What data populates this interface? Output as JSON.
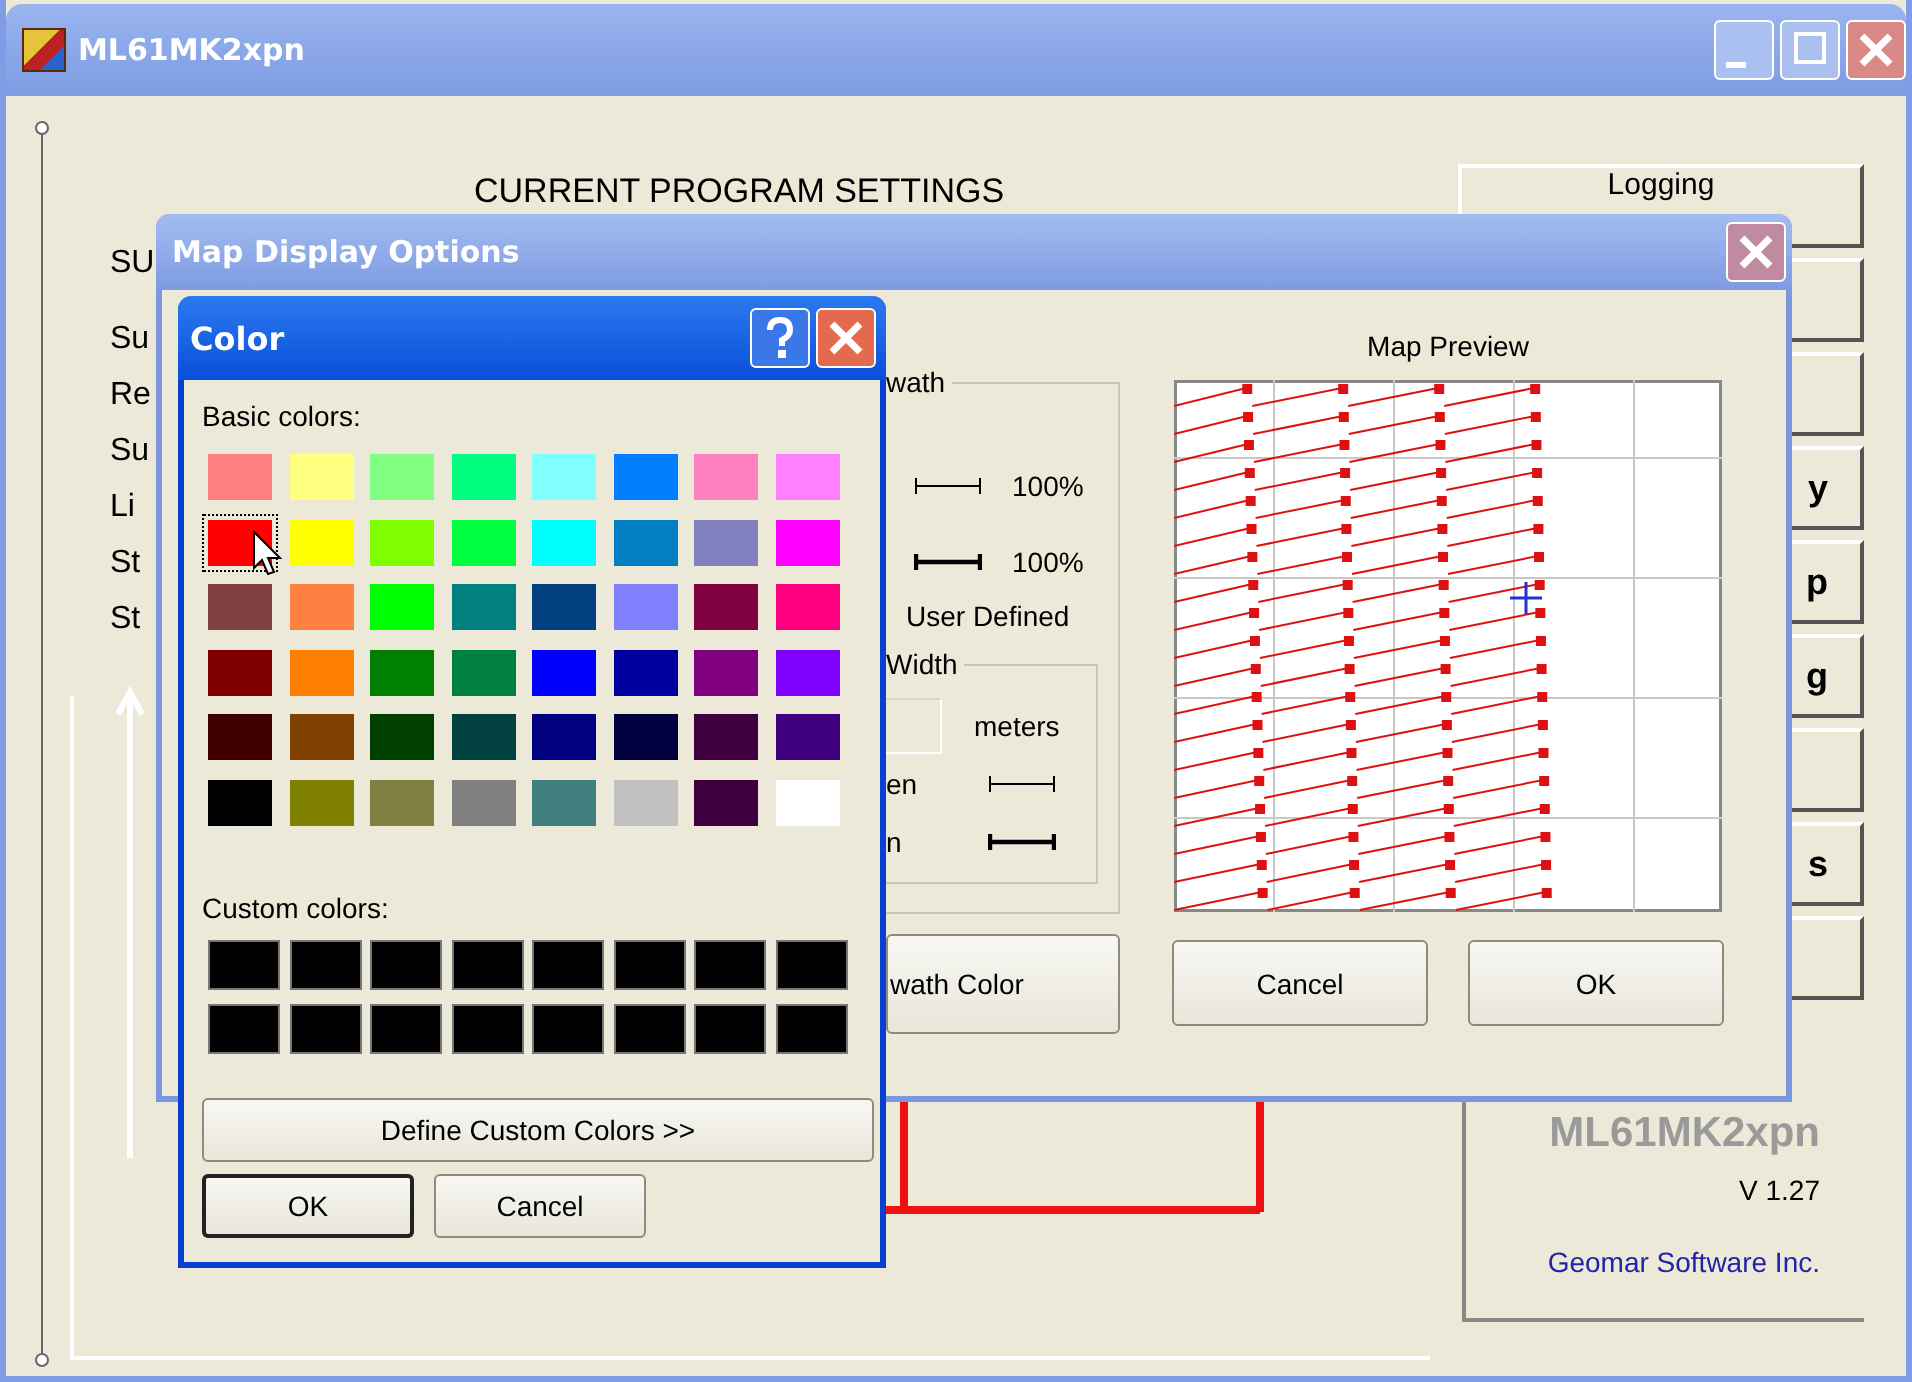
{
  "main_window": {
    "title": "ML61MK2xpn",
    "heading": "CURRENT PROGRAM SETTINGS",
    "setting_labels": [
      "SU",
      "Su",
      "Re",
      "Su",
      "Li",
      "St",
      "St"
    ],
    "buttons": [
      {
        "kind": "text",
        "label": "Logging"
      },
      {
        "kind": "blank"
      },
      {
        "kind": "blank"
      },
      {
        "kind": "text",
        "label": "y"
      },
      {
        "kind": "text",
        "label": "p"
      },
      {
        "kind": "text",
        "label": "g"
      },
      {
        "kind": "blank"
      },
      {
        "kind": "text",
        "label": "s"
      },
      {
        "kind": "blank"
      }
    ],
    "product_name": "ML61MK2xpn",
    "version": "V 1.27",
    "company": "Geomar Software Inc."
  },
  "map_dialog": {
    "title": "Map Display Options",
    "swath_group": "wath",
    "swath_rows": [
      {
        "kind": "thin",
        "value": "100%"
      },
      {
        "kind": "thick",
        "value": "100%"
      }
    ],
    "user_defined": "User Defined",
    "width_group": "Width",
    "width_unit": "meters",
    "width_rows": [
      {
        "kind": "thin",
        "label": "en"
      },
      {
        "kind": "thick",
        "label": "n"
      }
    ],
    "swath_color_button": "wath Color",
    "preview_title": "Map Preview",
    "buttons": [
      "Cancel",
      "OK"
    ]
  },
  "color_dialog": {
    "title": "Color",
    "basic_label": "Basic colors:",
    "basic_colors": [
      {
        "color": "#ff8080",
        "selected": false
      },
      {
        "color": "#ffff80",
        "selected": false
      },
      {
        "color": "#80ff80",
        "selected": false
      },
      {
        "color": "#00ff80",
        "selected": false
      },
      {
        "color": "#80ffff",
        "selected": false
      },
      {
        "color": "#0080ff",
        "selected": false
      },
      {
        "color": "#ff80c0",
        "selected": false
      },
      {
        "color": "#ff80ff",
        "selected": false
      },
      {
        "color": "#ff0000",
        "selected": true
      },
      {
        "color": "#ffff00",
        "selected": false
      },
      {
        "color": "#80ff00",
        "selected": false
      },
      {
        "color": "#00ff40",
        "selected": false
      },
      {
        "color": "#00ffff",
        "selected": false
      },
      {
        "color": "#0080c0",
        "selected": false
      },
      {
        "color": "#8080c0",
        "selected": false
      },
      {
        "color": "#ff00ff",
        "selected": false
      },
      {
        "color": "#804040",
        "selected": false
      },
      {
        "color": "#ff8040",
        "selected": false
      },
      {
        "color": "#00ff00",
        "selected": false
      },
      {
        "color": "#008080",
        "selected": false
      },
      {
        "color": "#004080",
        "selected": false
      },
      {
        "color": "#8080ff",
        "selected": false
      },
      {
        "color": "#800040",
        "selected": false
      },
      {
        "color": "#ff0080",
        "selected": false
      },
      {
        "color": "#800000",
        "selected": false
      },
      {
        "color": "#ff8000",
        "selected": false
      },
      {
        "color": "#008000",
        "selected": false
      },
      {
        "color": "#008040",
        "selected": false
      },
      {
        "color": "#0000ff",
        "selected": false
      },
      {
        "color": "#0000a0",
        "selected": false
      },
      {
        "color": "#800080",
        "selected": false
      },
      {
        "color": "#8000ff",
        "selected": false
      },
      {
        "color": "#400000",
        "selected": false
      },
      {
        "color": "#804000",
        "selected": false
      },
      {
        "color": "#004000",
        "selected": false
      },
      {
        "color": "#004040",
        "selected": false
      },
      {
        "color": "#000080",
        "selected": false
      },
      {
        "color": "#000040",
        "selected": false
      },
      {
        "color": "#400040",
        "selected": false
      },
      {
        "color": "#400080",
        "selected": false
      },
      {
        "color": "#000000",
        "selected": false
      },
      {
        "color": "#808000",
        "selected": false
      },
      {
        "color": "#808040",
        "selected": false
      },
      {
        "color": "#808080",
        "selected": false
      },
      {
        "color": "#408080",
        "selected": false
      },
      {
        "color": "#c0c0c0",
        "selected": false
      },
      {
        "color": "#400040",
        "selected": false
      },
      {
        "color": "#ffffff",
        "selected": false
      }
    ],
    "custom_label": "Custom colors:",
    "custom_colors": [
      {
        "color": "#000000"
      },
      {
        "color": "#000000"
      },
      {
        "color": "#000000"
      },
      {
        "color": "#000000"
      },
      {
        "color": "#000000"
      },
      {
        "color": "#000000"
      },
      {
        "color": "#000000"
      },
      {
        "color": "#000000"
      },
      {
        "color": "#000000"
      },
      {
        "color": "#000000"
      },
      {
        "color": "#000000"
      },
      {
        "color": "#000000"
      },
      {
        "color": "#000000"
      },
      {
        "color": "#000000"
      },
      {
        "color": "#000000"
      },
      {
        "color": "#000000"
      }
    ],
    "define_button": "Define Custom Colors >>",
    "buttons": [
      {
        "label": "OK",
        "default": true
      },
      {
        "label": "Cancel",
        "default": false
      }
    ]
  }
}
